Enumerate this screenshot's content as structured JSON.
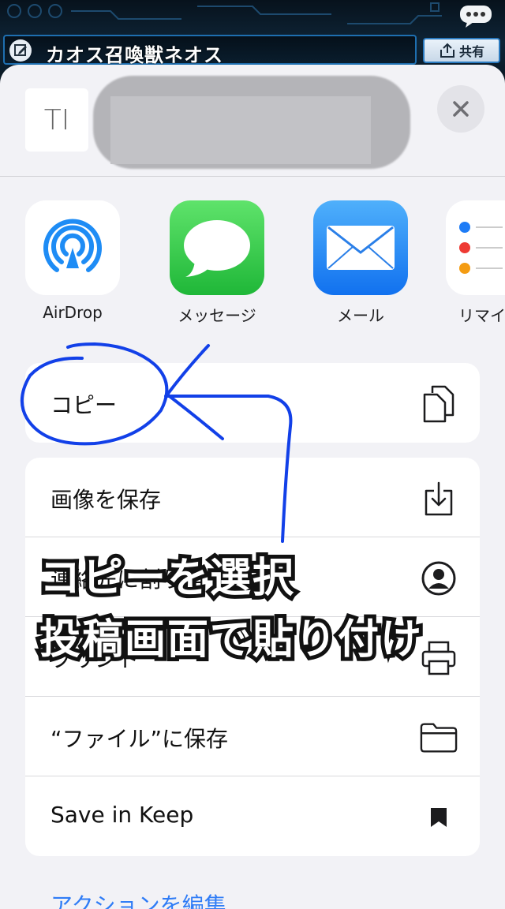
{
  "header": {
    "title": "カオス召喚獣ネオス",
    "share_label": "共有"
  },
  "sheet": {
    "preview_icon_text": "TI"
  },
  "apps": [
    {
      "label": "AirDrop",
      "icon": "airdrop-icon"
    },
    {
      "label": "メッセージ",
      "icon": "messages-icon"
    },
    {
      "label": "メール",
      "icon": "mail-icon"
    },
    {
      "label": "リマイ",
      "icon": "reminders-icon"
    }
  ],
  "actions": {
    "copy": {
      "label": "コピー",
      "icon": "copy-icon"
    },
    "save_image": {
      "label": "画像を保存",
      "icon": "download-icon"
    },
    "assign_contact": {
      "label": "連絡先に割り当てる",
      "icon": "person-circle-icon"
    },
    "print": {
      "label": "プリント",
      "icon": "printer-icon"
    },
    "save_files": {
      "label": "“ファイル”に保存",
      "icon": "folder-icon"
    },
    "save_keep": {
      "label": "Save in Keep",
      "icon": "bookmark-icon"
    },
    "edit_actions": "アクションを編集"
  },
  "caption": {
    "line1": "コピーを選択",
    "line2": "投稿画面で貼り付け"
  },
  "colors": {
    "accent": "#2f7cf6",
    "annotation": "#1240e8",
    "messages_green": "#34c759",
    "mail_blue": "#1e8cf5"
  }
}
